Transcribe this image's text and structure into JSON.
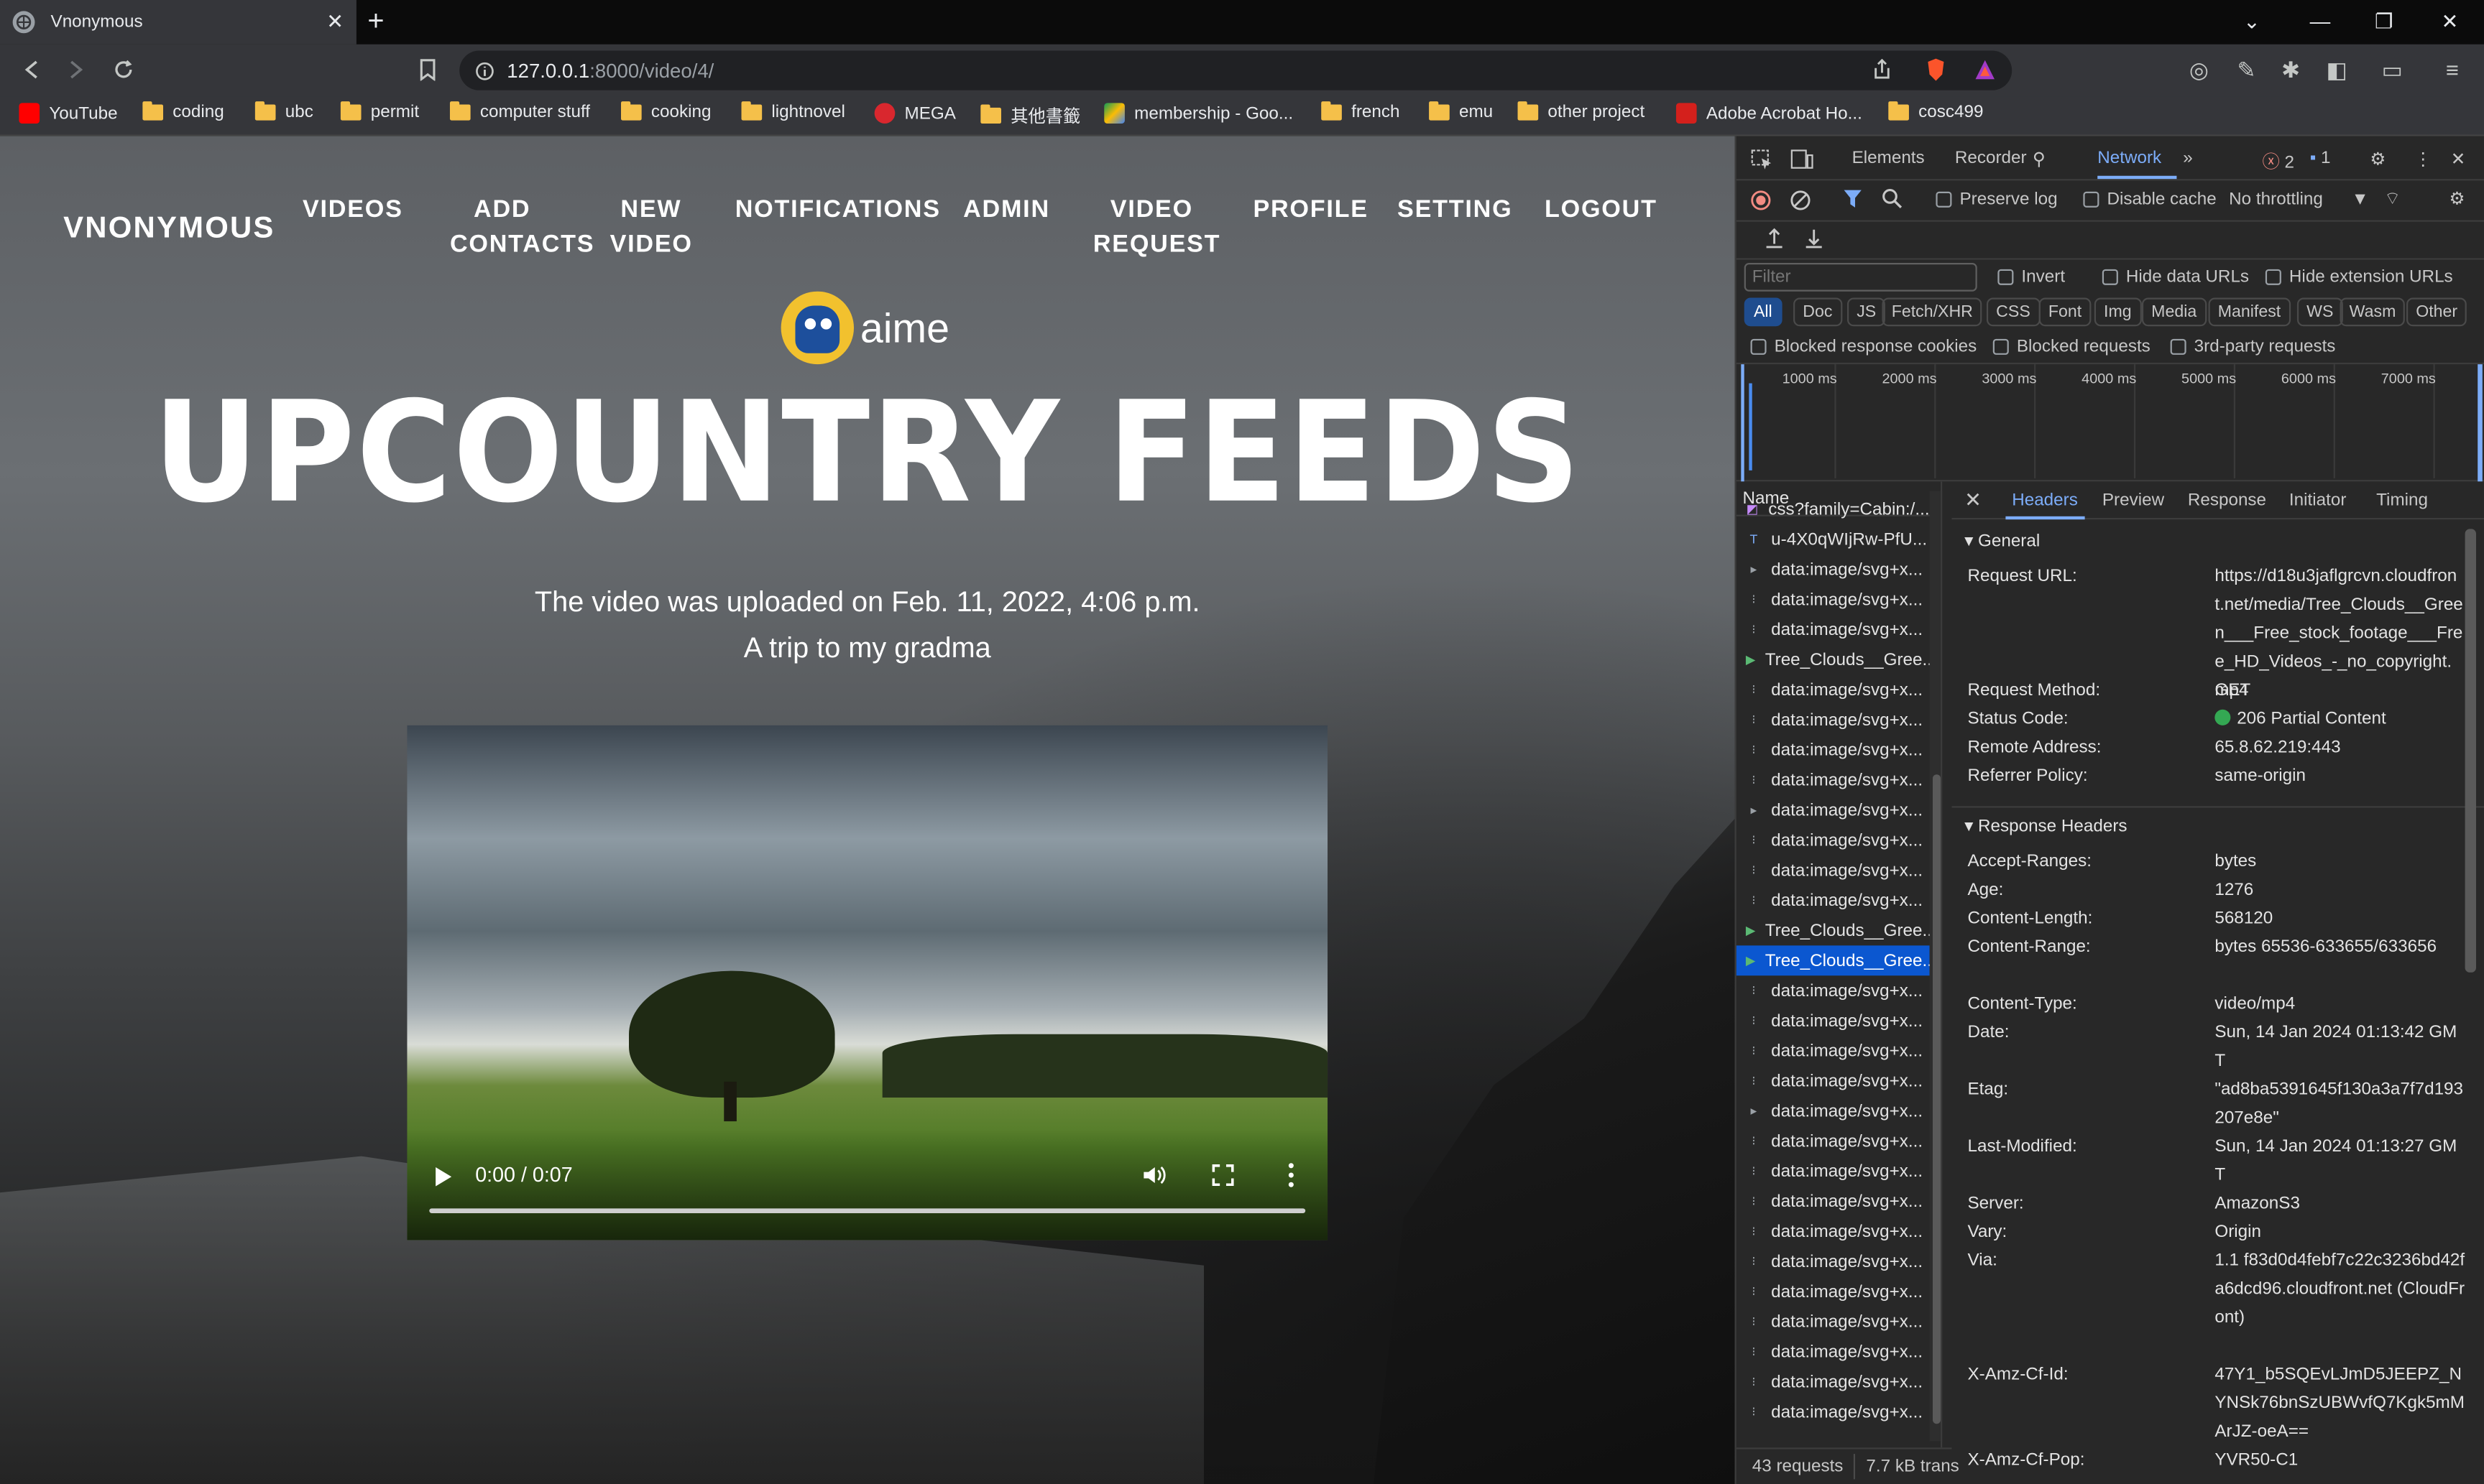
{
  "browser": {
    "tab_title": "Vnonymous",
    "url_host": "127.0.0.1",
    "url_rest": ":8000/video/4/",
    "bookmarks": [
      "YouTube",
      "coding",
      "ubc",
      "permit",
      "computer stuff",
      "cooking",
      "lightnovel",
      "MEGA",
      "其他書籤",
      "membership - Goo...",
      "french",
      "emu",
      "other project",
      "Adobe Acrobat Ho...",
      "cosc499"
    ]
  },
  "site": {
    "brand": "VNONYMOUS",
    "nav": [
      "VIDEOS",
      "ADD\nCONTACTS",
      "NEW\nVIDEO",
      "NOTIFICATIONS",
      "ADMIN",
      "VIDEO\nREQUEST",
      "PROFILE",
      "SETTING",
      "LOGOUT"
    ],
    "username": "aime",
    "title": "UPCOUNTRY FEEDS",
    "uploaded": "The video was uploaded on Feb. 11, 2022, 4:06 p.m.",
    "description": "A trip to my gradma",
    "video_time": "0:00 / 0:07",
    "video_progress": 0
  },
  "devtools": {
    "tabs": [
      "Elements",
      "Recorder",
      "Network"
    ],
    "errors": "2",
    "messages": "1",
    "preserve_log": "Preserve log",
    "disable_cache": "Disable cache",
    "throttling": "No throttling",
    "filter_placeholder": "Filter",
    "invert": "Invert",
    "hide_data_urls": "Hide data URLs",
    "hide_ext_urls": "Hide extension URLs",
    "types": [
      "All",
      "Doc",
      "JS",
      "Fetch/XHR",
      "CSS",
      "Font",
      "Img",
      "Media",
      "Manifest",
      "WS",
      "Wasm",
      "Other"
    ],
    "blocked_cookies": "Blocked response cookies",
    "blocked_requests": "Blocked requests",
    "third_party": "3rd-party requests",
    "timeline": [
      "1000 ms",
      "2000 ms",
      "3000 ms",
      "4000 ms",
      "5000 ms",
      "6000 ms",
      "7000 ms"
    ],
    "name_header": "Name",
    "requests": [
      "css?family=Cabin:/...",
      "u-4X0qWIjRw-PfU...",
      "data:image/svg+x...",
      "data:image/svg+x...",
      "data:image/svg+x...",
      "Tree_Clouds__Gree...",
      "data:image/svg+x...",
      "data:image/svg+x...",
      "data:image/svg+x...",
      "data:image/svg+x...",
      "data:image/svg+x...",
      "data:image/svg+x...",
      "data:image/svg+x...",
      "data:image/svg+x...",
      "Tree_Clouds__Gree...",
      "Tree_Clouds__Gree...",
      "data:image/svg+x...",
      "data:image/svg+x...",
      "data:image/svg+x...",
      "data:image/svg+x...",
      "data:image/svg+x...",
      "data:image/svg+x...",
      "data:image/svg+x...",
      "data:image/svg+x...",
      "data:image/svg+x...",
      "data:image/svg+x...",
      "data:image/svg+x...",
      "data:image/svg+x...",
      "data:image/svg+x...",
      "data:image/svg+x...",
      "data:image/svg+x..."
    ],
    "status_requests": "43 requests",
    "status_transfer": "7.7 kB trans",
    "detail_tabs": [
      "Headers",
      "Preview",
      "Response",
      "Initiator",
      "Timing"
    ],
    "general": "General",
    "response_headers": "Response Headers",
    "general_rows": [
      {
        "k": "Request URL:",
        "v": "https://d18u3jaflgrcvn.cloudfront.net/media/Tree_Clouds__Green___Free_stock_footage___Free_HD_Videos_-_no_copyright.mp4"
      },
      {
        "k": "Request Method:",
        "v": "GET"
      },
      {
        "k": "Status Code:",
        "v": "206 Partial Content"
      },
      {
        "k": "Remote Address:",
        "v": "65.8.62.219:443"
      },
      {
        "k": "Referrer Policy:",
        "v": "same-origin"
      }
    ],
    "response_rows": [
      {
        "k": "Accept-Ranges:",
        "v": "bytes"
      },
      {
        "k": "Age:",
        "v": "1276"
      },
      {
        "k": "Content-Length:",
        "v": "568120"
      },
      {
        "k": "Content-Range:",
        "v": "bytes 65536-633655/633656"
      },
      {
        "k": "Content-Type:",
        "v": "video/mp4"
      },
      {
        "k": "Date:",
        "v": "Sun, 14 Jan 2024 01:13:42 GMT"
      },
      {
        "k": "Etag:",
        "v": "\"ad8ba5391645f130a3a7f7d193207e8e\""
      },
      {
        "k": "Last-Modified:",
        "v": "Sun, 14 Jan 2024 01:13:27 GMT"
      },
      {
        "k": "Server:",
        "v": "AmazonS3"
      },
      {
        "k": "Vary:",
        "v": "Origin"
      },
      {
        "k": "Via:",
        "v": "1.1 f83d0d4febf7c22c3236bd42fa6dcd96.cloudfront.net (CloudFront)"
      },
      {
        "k": "X-Amz-Cf-Id:",
        "v": "47Y1_b5SQEvLJmD5JEEPZ_NYNSk76bnSzUBWvfQ7Kgk5mMArJZ-oeA=="
      },
      {
        "k": "X-Amz-Cf-Pop:",
        "v": "YVR50-C1"
      }
    ]
  }
}
